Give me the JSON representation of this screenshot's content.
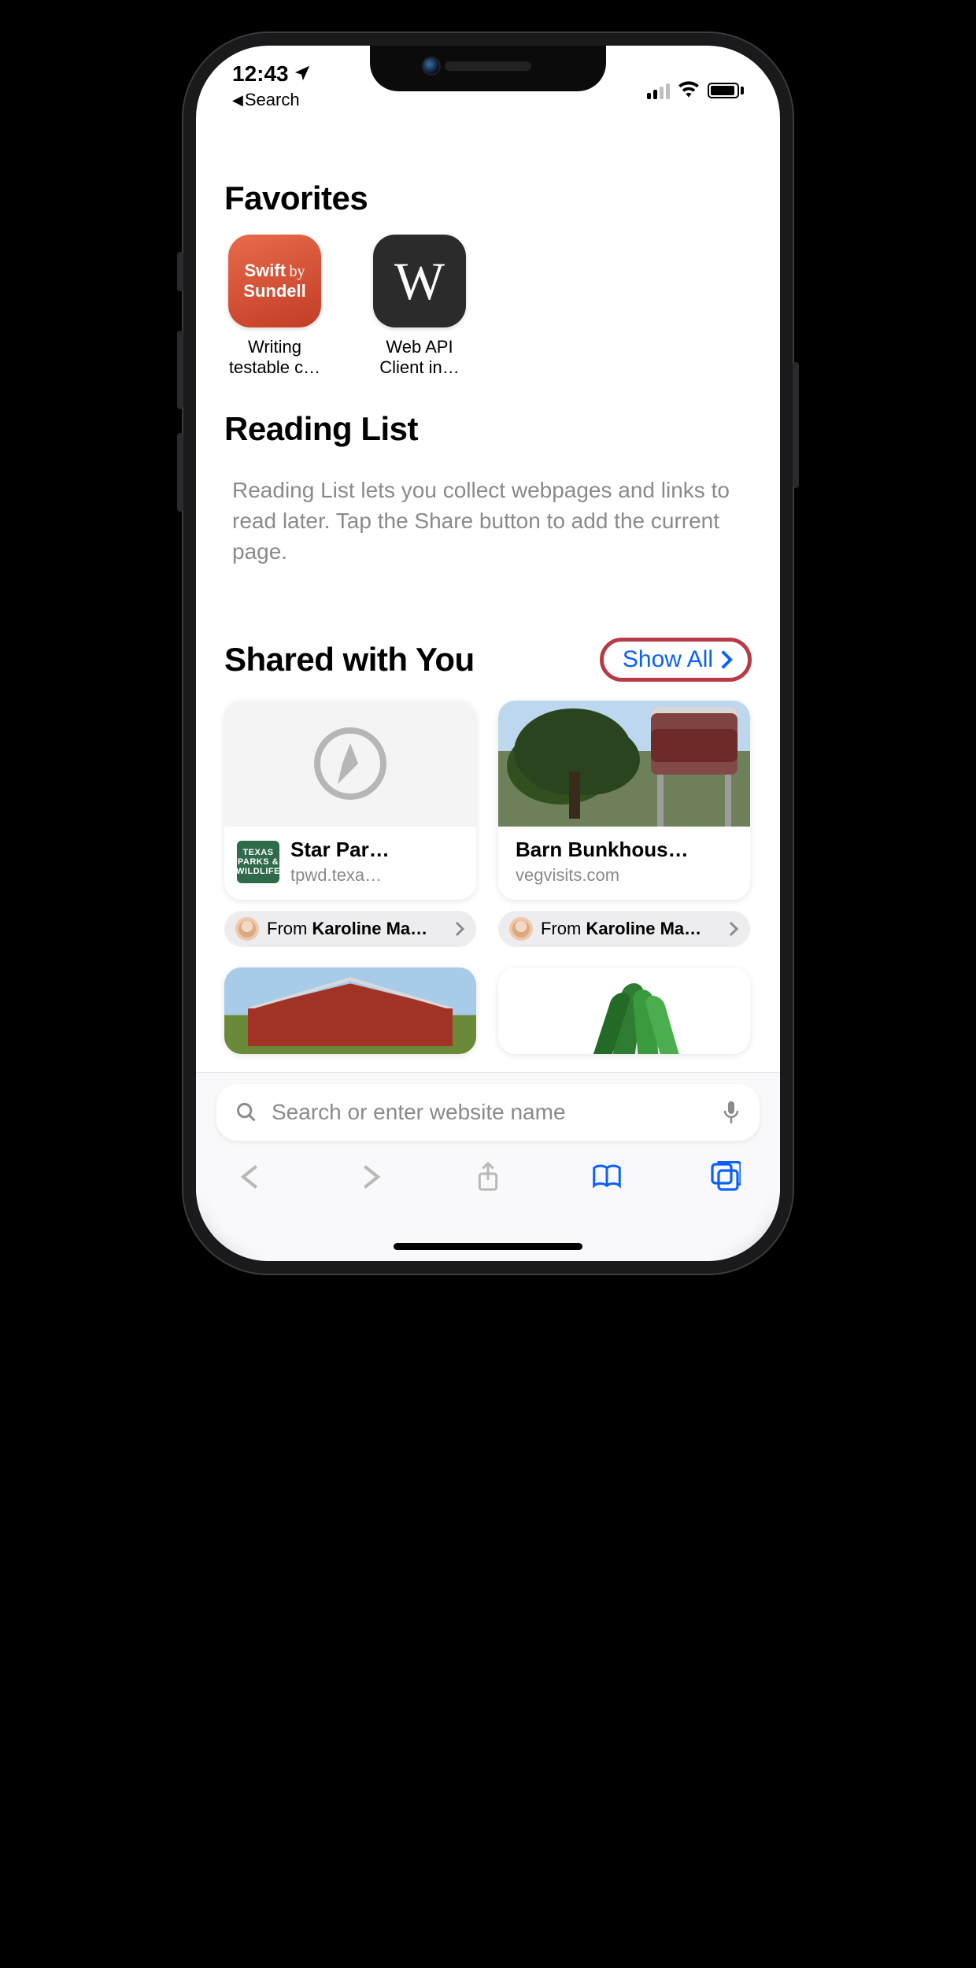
{
  "status": {
    "time": "12:43",
    "back_label": "Search"
  },
  "favorites": {
    "title": "Favorites",
    "items": [
      {
        "label": "Writing testable c…",
        "icon_text1": "Swift",
        "icon_by": "by",
        "icon_text2": "Sundell"
      },
      {
        "label": "Web API Client in…",
        "icon_letter": "W"
      }
    ]
  },
  "reading_list": {
    "title": "Reading List",
    "info": "Reading List lets you collect webpages and links to read later. Tap the Share button to add the current page."
  },
  "shared": {
    "title": "Shared with You",
    "show_all": "Show All",
    "cards": [
      {
        "title": "Star Par…",
        "url": "tpwd.texa…",
        "favicon": "TEXAS\nPARKS &\nWILDLIFE",
        "from_prefix": "From ",
        "from_name": "Karoline Ma…"
      },
      {
        "title": "Barn Bunkhous…",
        "url": "vegvisits.com",
        "from_prefix": "From ",
        "from_name": "Karoline Ma…"
      }
    ]
  },
  "url_bar": {
    "placeholder": "Search or enter website name"
  }
}
